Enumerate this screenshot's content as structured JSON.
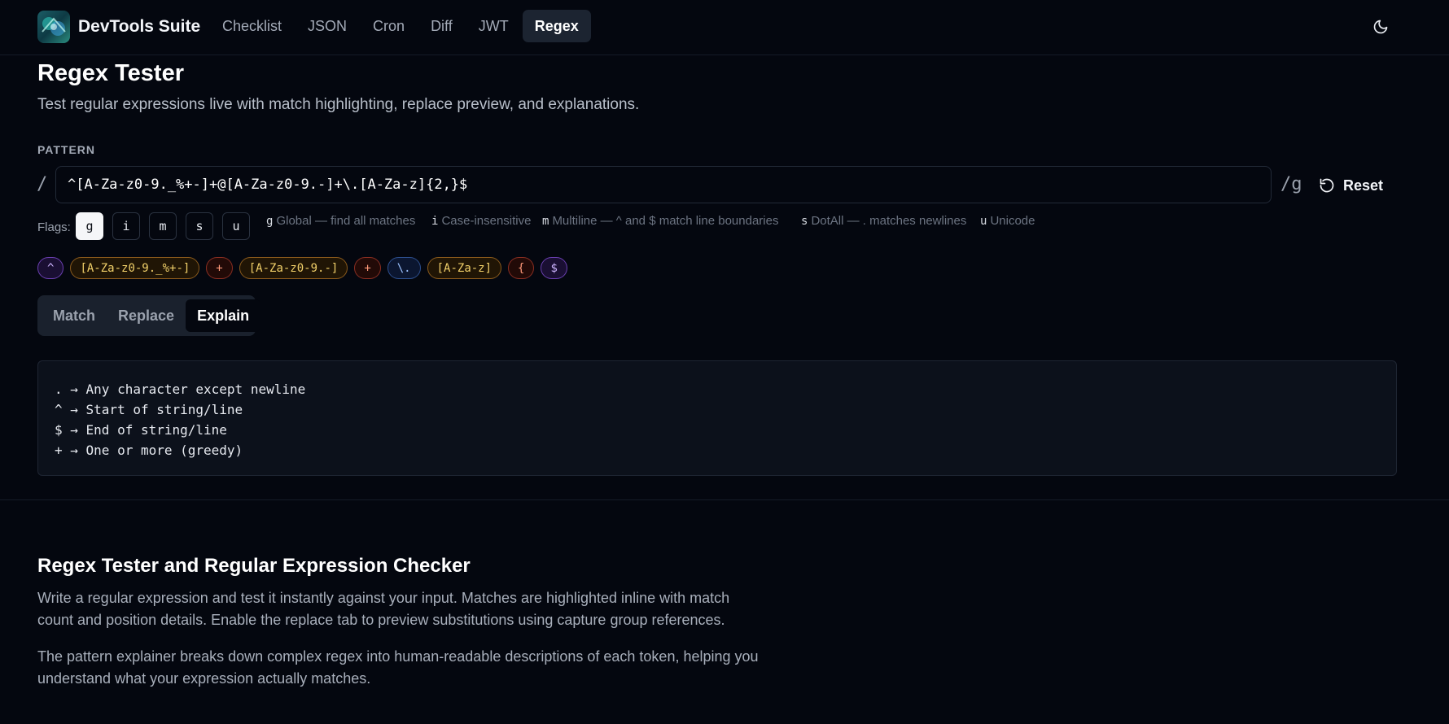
{
  "nav": {
    "brand": "DevTools Suite",
    "links": [
      "Checklist",
      "JSON",
      "Cron",
      "Diff",
      "JWT",
      "Regex"
    ],
    "active": "Regex"
  },
  "header": {
    "title": "Regex Tester",
    "subtitle": "Test regular expressions live with match highlighting, replace preview, and explanations."
  },
  "pattern": {
    "label": "PATTERN",
    "slash": "/",
    "value": "^[A-Za-z0-9._%+-]+@[A-Za-z0-9.-]+\\.[A-Za-z]{2,}$",
    "suffix": "/g",
    "reset_label": "Reset"
  },
  "flags": {
    "label": "Flags:",
    "buttons": [
      "g",
      "i",
      "m",
      "s",
      "u"
    ],
    "active": [
      "g"
    ],
    "descriptions": [
      {
        "key": "g",
        "text": "Global — find all matches"
      },
      {
        "key": "i",
        "text": "Case-insensitive"
      },
      {
        "key": "m",
        "text": "Multiline — ^ and $ match line boundaries"
      },
      {
        "key": "s",
        "text": "DotAll — . matches newlines"
      },
      {
        "key": "u",
        "text": "Unicode"
      }
    ]
  },
  "tokens": [
    {
      "text": "^",
      "color": "purple"
    },
    {
      "text": "[A-Za-z0-9._%+-]",
      "color": "yellow"
    },
    {
      "text": "+",
      "color": "red"
    },
    {
      "text": "[A-Za-z0-9.-]",
      "color": "yellow"
    },
    {
      "text": "+",
      "color": "red"
    },
    {
      "text": "\\.",
      "color": "blue"
    },
    {
      "text": "[A-Za-z]",
      "color": "yellow"
    },
    {
      "text": "{",
      "color": "red"
    },
    {
      "text": "$",
      "color": "purple"
    }
  ],
  "tabs": {
    "items": [
      "Match",
      "Replace",
      "Explain"
    ],
    "active": "Explain"
  },
  "explain": {
    "lines": [
      ". → Any character except newline",
      "^ → Start of string/line",
      "$ → End of string/line",
      "+ → One or more (greedy)"
    ]
  },
  "seo": {
    "title": "Regex Tester and Regular Expression Checker",
    "paragraph1": "Write a regular expression and test it instantly against your input. Matches are highlighted inline with match count and position details. Enable the replace tab to preview substitutions using capture group references.",
    "paragraph2": "The pattern explainer breaks down complex regex into human-readable descriptions of each token, helping you understand what your expression actually matches."
  },
  "colors": {
    "background": "#04070f",
    "active_nav": "#1c2431",
    "panel": "#0c111b"
  }
}
